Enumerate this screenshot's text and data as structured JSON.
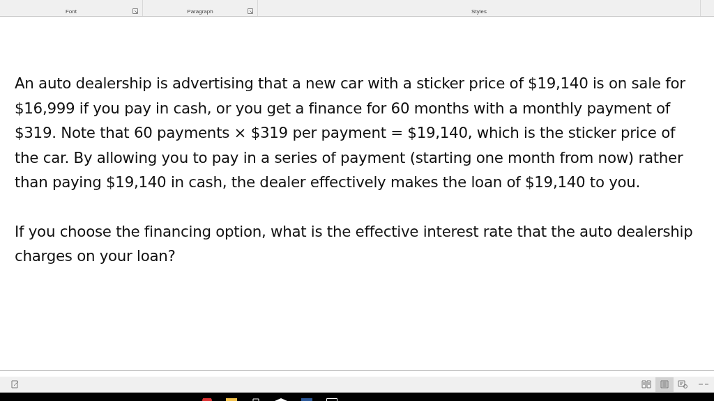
{
  "ribbon": {
    "groups": [
      {
        "label": "Font",
        "launcher": true
      },
      {
        "label": "Paragraph",
        "launcher": true
      },
      {
        "label": "Styles",
        "launcher": false
      }
    ]
  },
  "document": {
    "paragraphs": [
      "An auto dealership is advertising that a new car with a sticker price of $19,140 is on sale for $16,999 if you pay in cash, or you get a finance for 60 months with a monthly payment of $319. Note that 60 payments × $319 per payment = $19,140, which is the sticker price of the car. By allowing you to pay in a series of payment (starting one month from now) rather than paying $19,140 in cash, the dealer effectively makes the loan of $19,140 to you.",
      "If you choose the financing option, what is the effective interest rate that the auto dealership charges on your loan?"
    ]
  },
  "status_bar": {
    "views": [
      {
        "kind": "read",
        "selected": false
      },
      {
        "kind": "print",
        "selected": true
      },
      {
        "kind": "web",
        "selected": false
      }
    ]
  }
}
